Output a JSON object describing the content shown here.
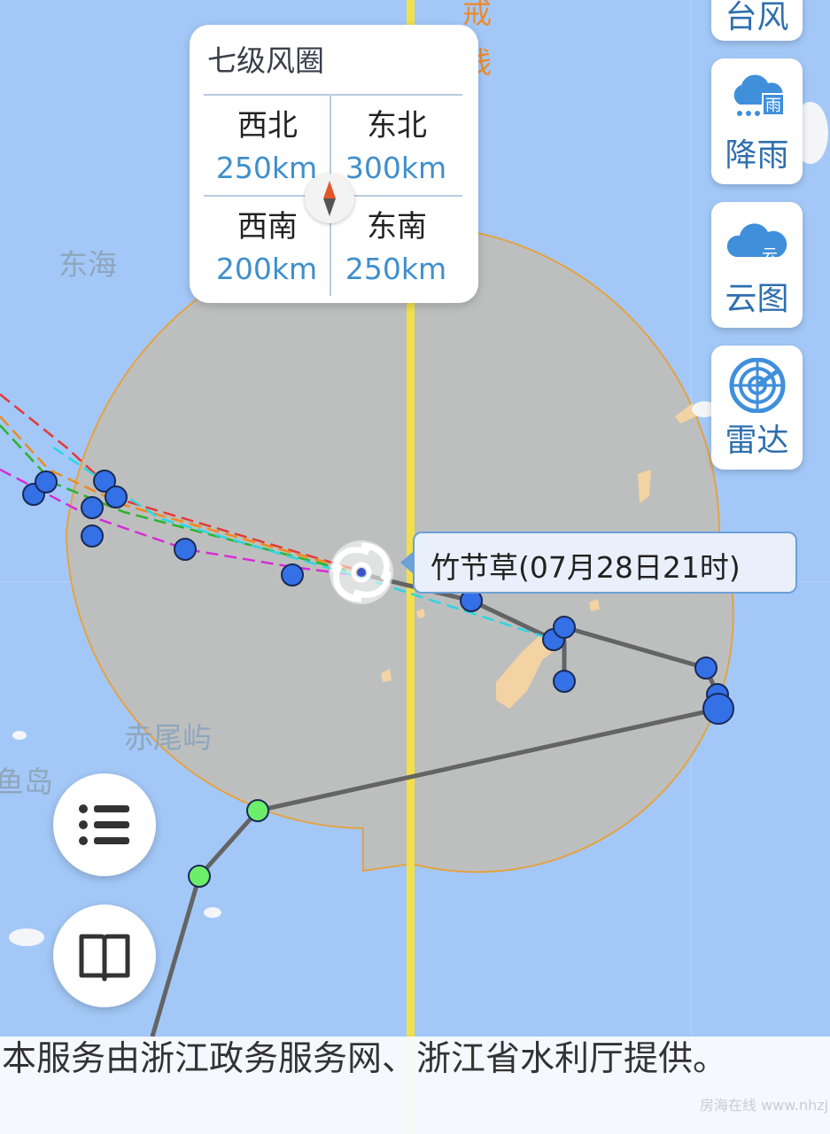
{
  "wind_circle": {
    "title": "七级风圈",
    "quadrants": [
      {
        "dir": "西北",
        "value": "250km"
      },
      {
        "dir": "东北",
        "value": "300km"
      },
      {
        "dir": "西南",
        "value": "200km"
      },
      {
        "dir": "东南",
        "value": "250km"
      }
    ]
  },
  "side_toolbar": {
    "typhoon_label": "台风",
    "rain_label": "降雨",
    "cloud_label": "云图",
    "radar_label": "雷达"
  },
  "typhoon_label": "竹节草(07月28日21时)",
  "places": {
    "east_sea": "东海",
    "chiweiyu": "赤尾屿",
    "diaoyudao_partial": "鱼岛",
    "warning_line_partial": [
      "戒",
      "线"
    ]
  },
  "footer_text": "本服务由浙江政务服务网、浙江省水利厅提供。",
  "watermark": "房海在线 www.nhzj.com",
  "icons": {
    "list": "list-icon",
    "book": "book-icon",
    "rain": "rain-cloud-icon",
    "cloud": "cloud-icon",
    "radar": "radar-icon",
    "compass": "compass-icon",
    "typhoon": "typhoon-icon"
  },
  "colors": {
    "sea": "#a3c8f7",
    "wind_circle_fill": "#bfbfbc",
    "wind_circle_border": "#e4a243",
    "warning_line": "#f2e04a",
    "track_past": "#646464",
    "point_blue": "#3470e6",
    "point_green": "#6dee6a",
    "accent": "#3f8fcc"
  }
}
